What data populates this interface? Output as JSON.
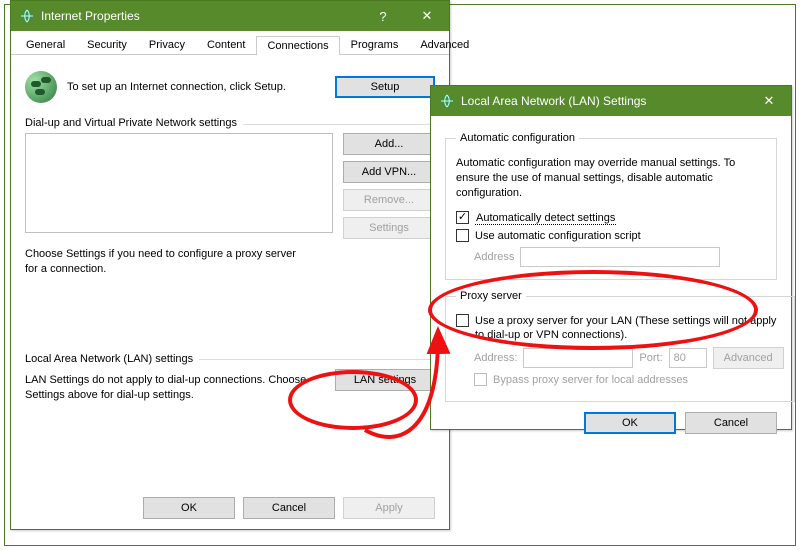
{
  "dlg1": {
    "title": "Internet Properties",
    "tabs": [
      "General",
      "Security",
      "Privacy",
      "Content",
      "Connections",
      "Programs",
      "Advanced"
    ],
    "active_tab": "Connections",
    "setup_text": "To set up an Internet connection, click Setup.",
    "setup_btn": "Setup",
    "dial_group": "Dial-up and Virtual Private Network settings",
    "btn_add": "Add...",
    "btn_addvpn": "Add VPN...",
    "btn_remove": "Remove...",
    "btn_settings": "Settings",
    "dial_note": "Choose Settings if you need to configure a proxy server for a connection.",
    "lan_group": "Local Area Network (LAN) settings",
    "lan_note": "LAN Settings do not apply to dial-up connections. Choose Settings above for dial-up settings.",
    "btn_lan": "LAN settings",
    "btn_ok": "OK",
    "btn_cancel": "Cancel",
    "btn_apply": "Apply"
  },
  "dlg2": {
    "title": "Local Area Network (LAN) Settings",
    "auto_group": "Automatic configuration",
    "auto_note": "Automatic configuration may override manual settings.  To ensure the use of manual settings, disable automatic configuration.",
    "chk_autodetect": "Automatically detect settings",
    "chk_script": "Use automatic configuration script",
    "lbl_address": "Address",
    "proxy_group": "Proxy server",
    "chk_proxy": "Use a proxy server for your LAN (These settings will not apply to dial-up or VPN connections).",
    "lbl_addr2": "Address:",
    "lbl_port": "Port:",
    "port_value": "80",
    "btn_adv": "Advanced",
    "chk_bypass": "Bypass proxy server for local addresses",
    "btn_ok": "OK",
    "btn_cancel": "Cancel"
  }
}
